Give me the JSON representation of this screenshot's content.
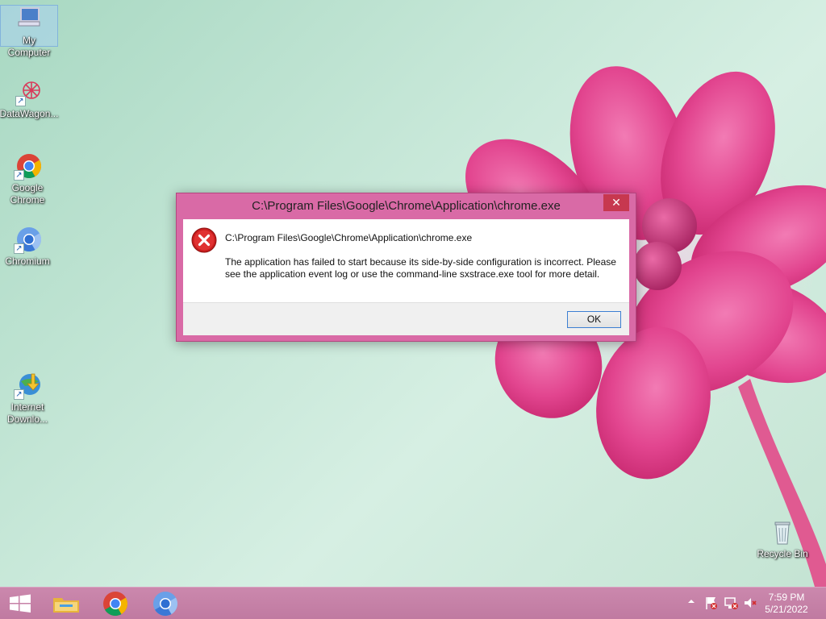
{
  "desktop": {
    "icons": [
      {
        "label": "My Computer",
        "icon": "computer-icon"
      },
      {
        "label": "DataWagon...",
        "icon": "datawagon-icon"
      },
      {
        "label": "Google Chrome",
        "icon": "chrome-icon"
      },
      {
        "label": "Chromium",
        "icon": "chromium-icon"
      },
      {
        "label": "Internet Downlo...",
        "icon": "internet-download-icon"
      },
      {
        "label": "Recycle Bin",
        "icon": "recycle-bin-icon"
      }
    ]
  },
  "dialog": {
    "title": "C:\\Program Files\\Google\\Chrome\\Application\\chrome.exe",
    "close_label": "✕",
    "path": "C:\\Program Files\\Google\\Chrome\\Application\\chrome.exe",
    "message": "The application has failed to start because its side-by-side configuration is incorrect. Please see the application event log or use the command-line sxstrace.exe tool for more detail.",
    "ok_label": "OK",
    "icon": "error-icon"
  },
  "taskbar": {
    "pinned": [
      "start-button",
      "file-explorer-icon",
      "chrome-icon",
      "chromium-icon"
    ],
    "tray": {
      "time": "7:59 PM",
      "date": "5/21/2022",
      "icons": [
        "show-hidden-icons",
        "action-center-flag-icon",
        "network-icon",
        "volume-muted-icon"
      ]
    }
  },
  "colors": {
    "dialog_frame": "#d96aa6",
    "taskbar": "#c07aa1",
    "close_button": "#c7384f",
    "ok_focus_border": "#3c7fd2"
  }
}
